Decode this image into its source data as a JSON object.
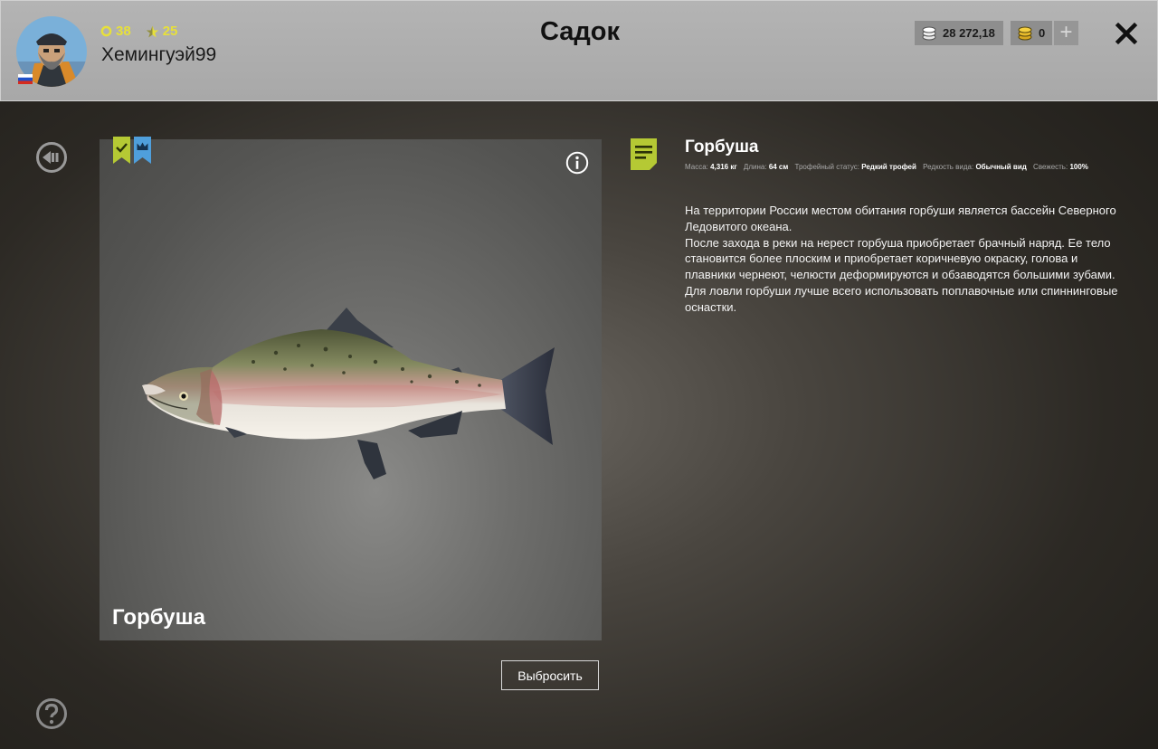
{
  "player": {
    "level_points": "38",
    "rank_points": "25",
    "username": "Хемингуэй99"
  },
  "page": {
    "title": "Садок"
  },
  "currency": {
    "silver": "28 272,18",
    "gold": "0",
    "add_label": "+"
  },
  "fish": {
    "name": "Горбуша",
    "meta": {
      "mass_label": "Масса:",
      "mass_value": "4,316 кг",
      "length_label": "Длина:",
      "length_value": "64 см",
      "trophy_label": "Трофейный статус:",
      "trophy_value": "Редкий трофей",
      "rarity_label": "Редкость вида:",
      "rarity_value": "Обычный вид",
      "freshness_label": "Свежесть:",
      "freshness_value": "100%"
    },
    "description": [
      "На территории России местом обитания горбуши является бассейн Северного Ледовитого океана.",
      "После захода в реки на нерест горбуша приобретает брачный наряд. Ее тело становится более плоским и приобретает коричневую окраску, голова и плавники чернеют, челюсти деформируются и обзаводятся большими зубами.",
      "Для ловли горбуши лучше всего использовать поплавочные или спиннинговые оснастки."
    ]
  },
  "actions": {
    "discard_label": "Выбросить"
  },
  "colors": {
    "accent_green": "#b5c934",
    "badge_blue": "#4f9fdc",
    "stat_yellow": "#e7e03a"
  }
}
